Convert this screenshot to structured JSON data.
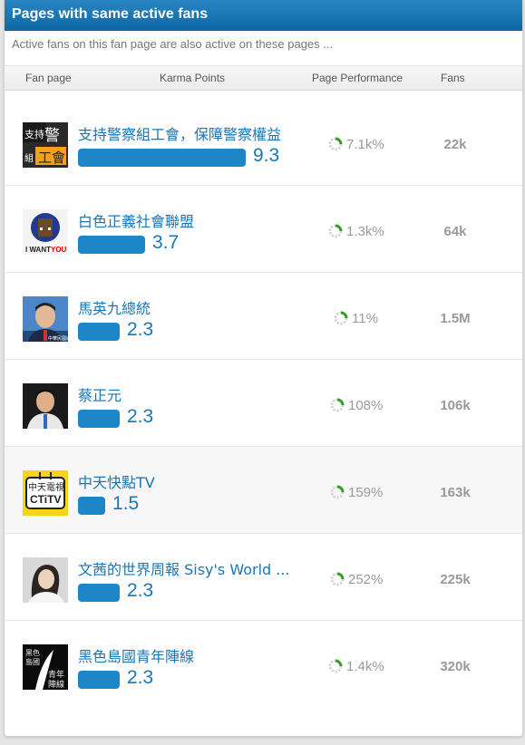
{
  "title": "Pages with same active fans",
  "subtitle": "Active fans on this fan page are also active on these pages ...",
  "columns": {
    "fan_page": "Fan page",
    "karma": "Karma Points",
    "performance": "Page Performance",
    "fans": "Fans"
  },
  "max_karma": 9.3,
  "colors": {
    "header": "#1274b5",
    "accent": "#1c86c6",
    "progress_ring": "#3a9a2a"
  },
  "rows": [
    {
      "name": "支持警察組工會，保障警察權益",
      "karma": "9.3",
      "karma_value": 9.3,
      "performance": "7.1k%",
      "fans": "22k",
      "avatar": "police-union-icon",
      "avatar_text": "支持警察組工會"
    },
    {
      "name": "白色正義社會聯盟",
      "karma": "3.7",
      "karma_value": 3.7,
      "performance": "1.3k%",
      "fans": "64k",
      "avatar": "white-justice-icon",
      "avatar_text": "I WANT YOU"
    },
    {
      "name": "馬英九總統",
      "karma": "2.3",
      "karma_value": 2.3,
      "performance": "11%",
      "fans": "1.5M",
      "avatar": "president-photo",
      "avatar_text": ""
    },
    {
      "name": "蔡正元",
      "karma": "2.3",
      "karma_value": 2.3,
      "performance": "108%",
      "fans": "106k",
      "avatar": "politician-photo",
      "avatar_text": ""
    },
    {
      "name": "中天快點TV",
      "karma": "1.5",
      "karma_value": 1.5,
      "performance": "159%",
      "fans": "163k",
      "avatar": "ctitv-logo",
      "avatar_text": "中天電視 CTiTV"
    },
    {
      "name": "文茜的世界周報 Sisy's World ...",
      "karma": "2.3",
      "karma_value": 2.3,
      "performance": "252%",
      "fans": "225k",
      "avatar": "woman-photo",
      "avatar_text": ""
    },
    {
      "name": "黑色島國青年陣線",
      "karma": "2.3",
      "karma_value": 2.3,
      "performance": "1.4k%",
      "fans": "320k",
      "avatar": "black-island-icon",
      "avatar_text": "黑色島國青年陣線"
    }
  ]
}
